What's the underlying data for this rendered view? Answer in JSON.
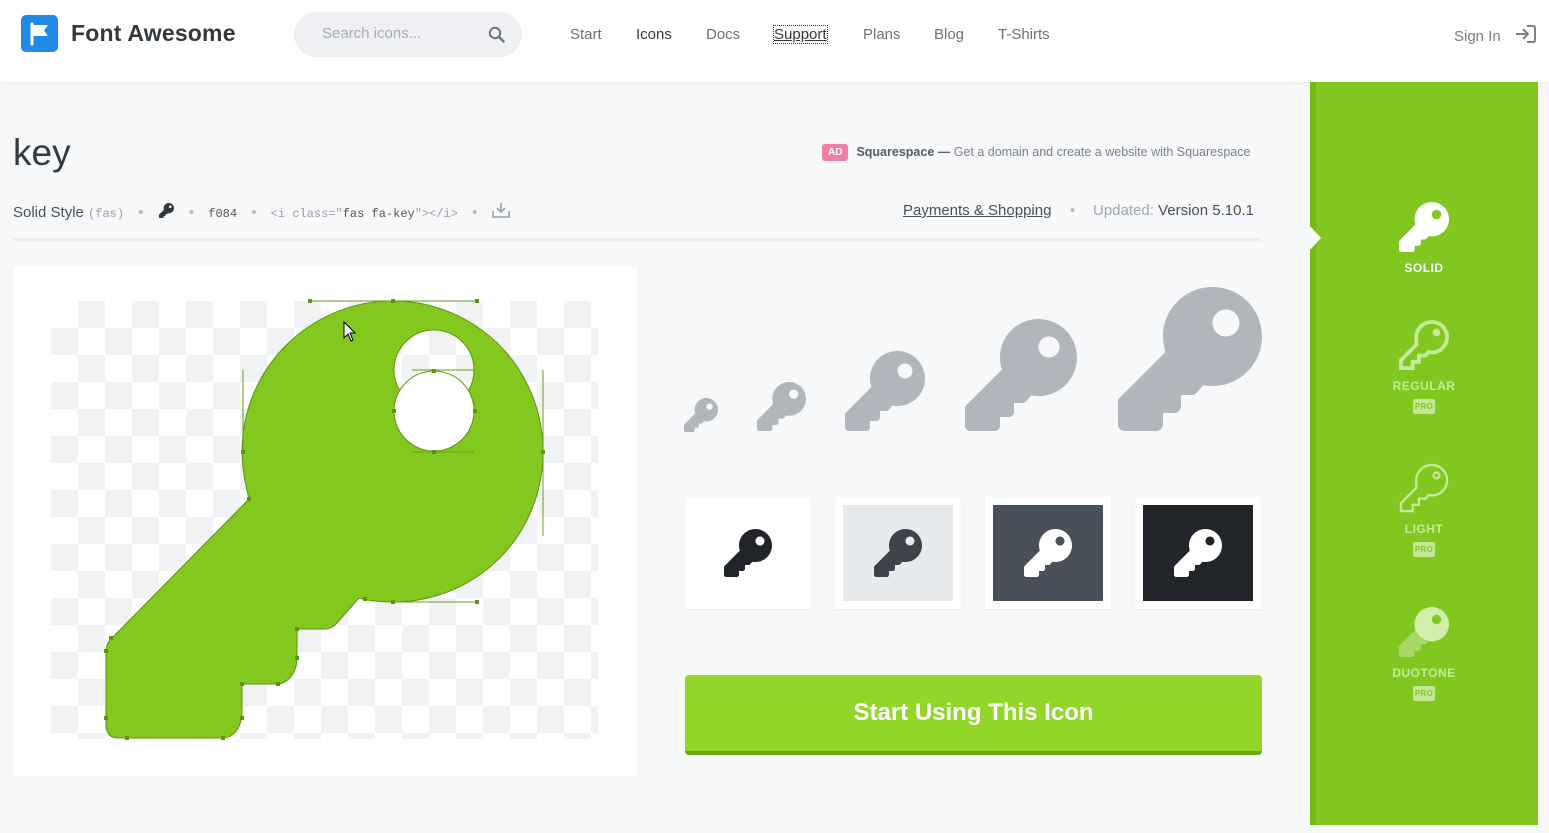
{
  "header": {
    "brand": "Font Awesome",
    "search_placeholder": "Search icons...",
    "nav": [
      "Start",
      "Icons",
      "Docs",
      "Support",
      "Plans",
      "Blog",
      "T-Shirts"
    ],
    "signin": "Sign In"
  },
  "icon": {
    "name": "key",
    "style_label": "Solid Style",
    "style_prefix": "(fas)",
    "unicode": "f084",
    "html_prefix": "<i class=\"",
    "html_class": "fas fa-key",
    "html_suffix": "\"></i>",
    "category": "Payments & Shopping",
    "updated_label": "Updated:",
    "version": "Version 5.10.1"
  },
  "ad": {
    "badge": "AD",
    "brand": "Squarespace —",
    "text": "Get a domain and create a website with Squarespace"
  },
  "styles": [
    {
      "label": "SOLID",
      "pro": false
    },
    {
      "label": "REGULAR",
      "pro": true
    },
    {
      "label": "LIGHT",
      "pro": true
    },
    {
      "label": "DUOTONE",
      "pro": true
    }
  ],
  "pro_badge": "PRO",
  "cta": "Start Using This Icon",
  "colors": {
    "accent": "#80c81f",
    "brand_blue": "#228ae6",
    "preview_gray": "#b1b6bc",
    "ad_pink": "#f17ea3"
  }
}
